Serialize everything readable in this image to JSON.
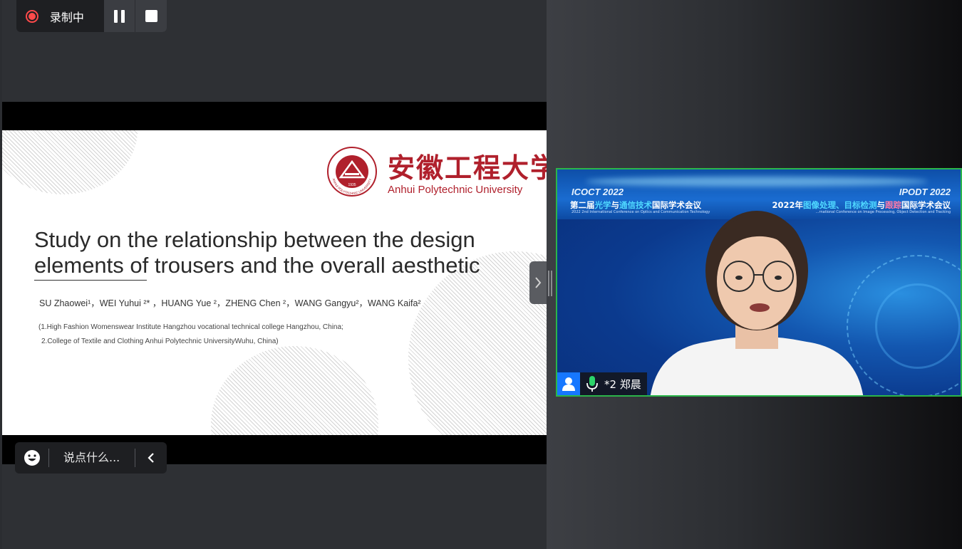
{
  "recording": {
    "label": "录制中",
    "pause_icon": "pause-icon",
    "stop_icon": "stop-icon",
    "indicator_color": "#ff4a4a"
  },
  "slide": {
    "university_cn": "安徽工程大学",
    "university_en": "Anhui Polytechnic University",
    "seal_year": "1935",
    "seal_text": "ANHUI POLYTECHNIC UNIVERSITY",
    "title_line1": "Study on the relationship between the design",
    "title_line2": "elements of trousers and the overall aesthetic",
    "authors": "SU Zhaowei¹，WEI Yuhui ²* ，HUANG Yue ²，ZHENG Chen ²，WANG Gangyu²，WANG Kaifa²",
    "affiliation1": "(1.High Fashion Womenswear Institute Hangzhou vocational technical college Hangzhou, China;",
    "affiliation2": "2.College of Textile and Clothing Anhui Polytechnic UniversityWuhu, China)",
    "accent_color": "#b0202c"
  },
  "chat": {
    "placeholder": "说点什么...",
    "emoji_icon": "emoji-icon",
    "collapse_icon": "chevron-left-icon"
  },
  "panel_toggle_icon": "chevron-right-icon",
  "video": {
    "left_tag": "ICOCT 2022",
    "left_cn_prefix": "第二届",
    "left_cn_hl1": "光学",
    "left_cn_mid": "与",
    "left_cn_hl2": "通信技术",
    "left_cn_suffix": "国际学术会议",
    "left_en": "2022 2nd International Conference on Optics and Communication Technology",
    "right_tag": "IPODT 2022",
    "right_cn_prefix": "2022年",
    "right_cn_hl1": "图像处理、目标检测",
    "right_cn_mid": "与",
    "right_cn_hl2": "跟踪",
    "right_cn_suffix": "国际学术会议",
    "right_en": "…rnational Conference on Image Processing, Object Detection and Tracking",
    "participant_name": "*2 郑晨",
    "active_border_color": "#2bb54a",
    "avatar_color": "#1677ff",
    "mic_color": "#2bd46a"
  }
}
